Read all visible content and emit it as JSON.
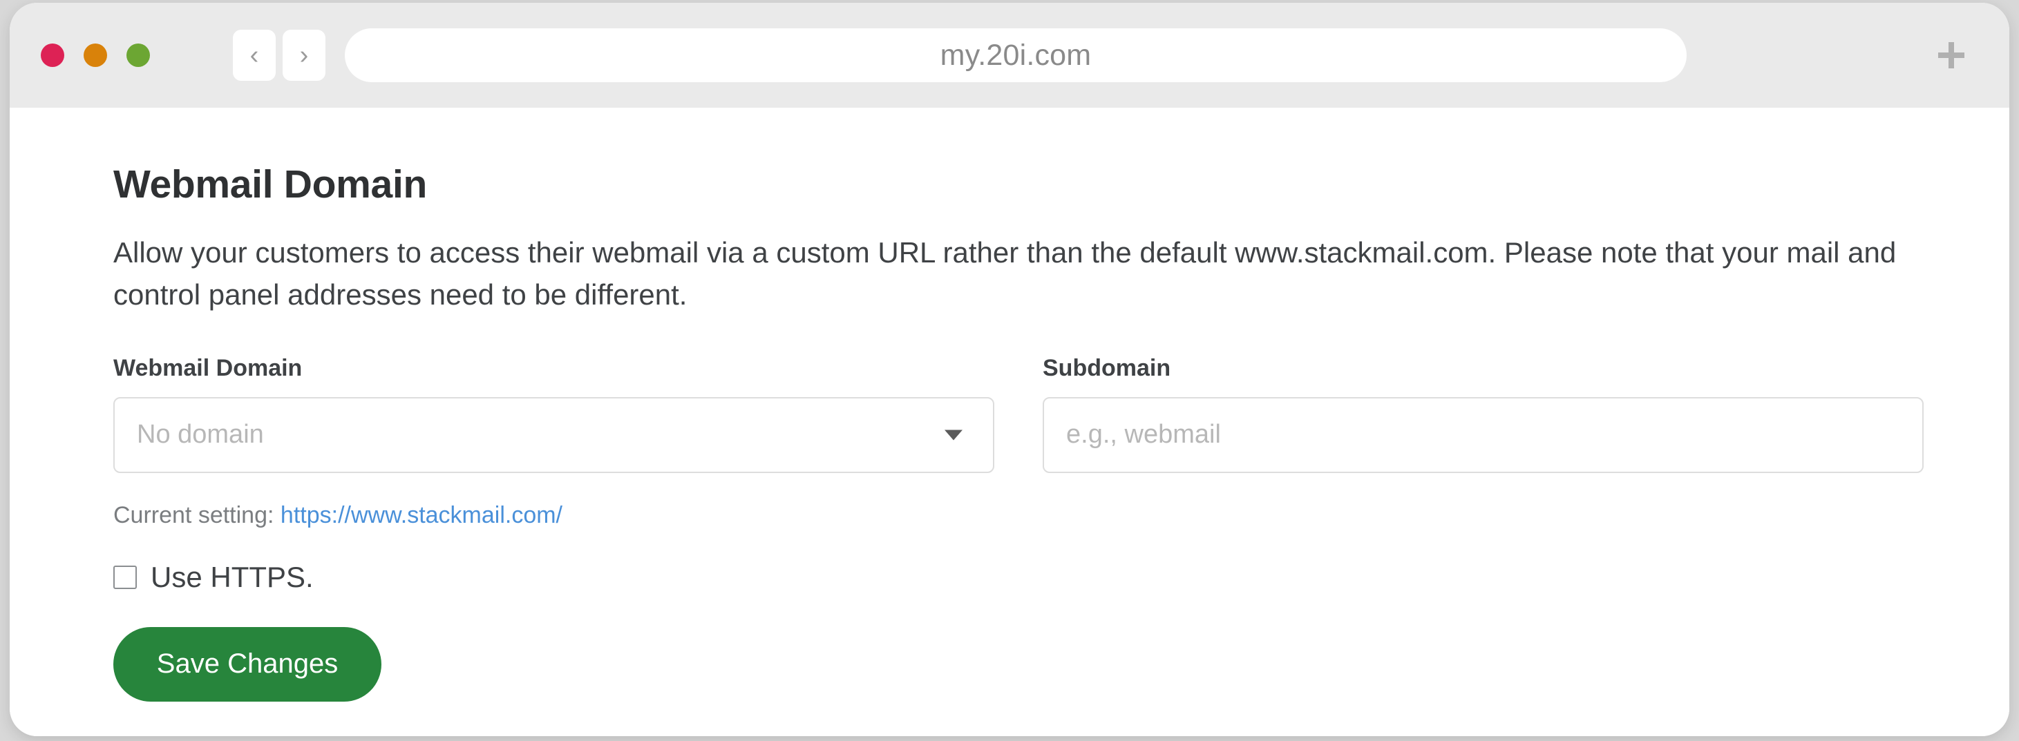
{
  "browser": {
    "url": "my.20i.com",
    "back_label": "‹",
    "forward_label": "›",
    "new_tab_label": "+"
  },
  "page": {
    "title": "Webmail Domain",
    "description": "Allow your customers to access their webmail via a custom URL rather than the default www.stackmail.com. Please note that your mail and control panel addresses need to be different.",
    "fields": {
      "domain": {
        "label": "Webmail Domain",
        "value": "No domain",
        "options": [
          "No domain"
        ]
      },
      "subdomain": {
        "label": "Subdomain",
        "value": "",
        "placeholder": "e.g., webmail"
      }
    },
    "current_setting": {
      "prefix": "Current setting:",
      "link_text": "https://www.stackmail.com/"
    },
    "https_checkbox": {
      "label": "Use HTTPS.",
      "checked": false
    },
    "save_button": "Save Changes"
  },
  "colors": {
    "accent_green": "#27853c",
    "link_blue": "#4a90d9",
    "chrome_gray": "#eaeaea"
  }
}
